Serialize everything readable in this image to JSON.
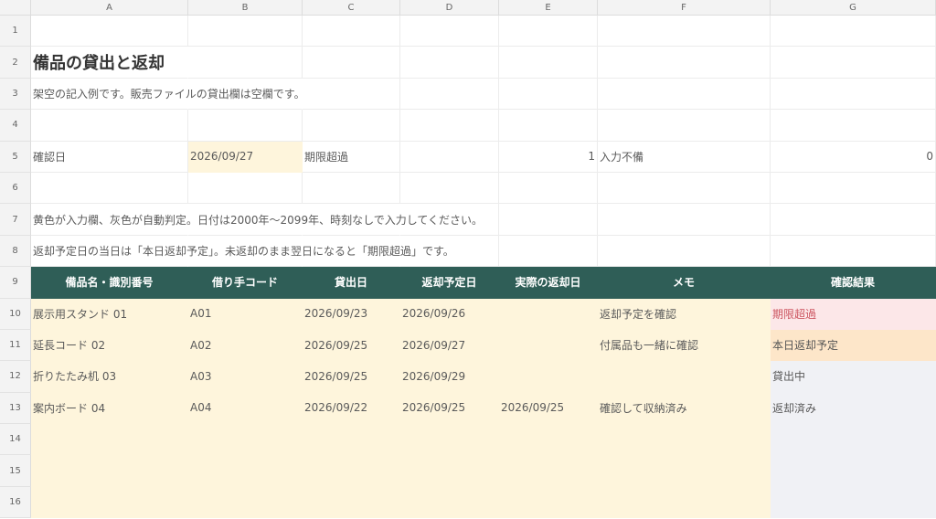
{
  "sheet": {
    "column_headers": [
      "A",
      "B",
      "C",
      "D",
      "E",
      "F",
      "G"
    ],
    "row_numbers": [
      "1",
      "2",
      "3",
      "4",
      "5",
      "6",
      "7",
      "8",
      "9",
      "10",
      "11",
      "12",
      "13",
      "14",
      "15",
      "16"
    ],
    "title": "備品の貸出と返却",
    "subtitle": "架空の記入例です。販売ファイルの貸出欄は空欄です。",
    "summary": {
      "date_label": "確認日",
      "date_value": "2026/09/27",
      "overdue_label": "期限超過",
      "overdue_count": "1",
      "missing_label": "入力不備",
      "missing_count": "0"
    },
    "notes": [
      "黄色が入力欄、灰色が自動判定。日付は2000年〜2099年、時刻なしで入力してください。",
      "返却予定日の当日は「本日返却予定」。未返却のまま翌日になると「期限超過」です。"
    ],
    "table": {
      "headers": [
        "備品名・識別番号",
        "借り手コード",
        "貸出日",
        "返却予定日",
        "実際の返却日",
        "メモ",
        "確認結果"
      ],
      "rows": [
        [
          "展示用スタンド 01",
          "A01",
          "2026/09/23",
          "2026/09/26",
          "",
          "返却予定を確認",
          "期限超過"
        ],
        [
          "延長コード 02",
          "A02",
          "2026/09/25",
          "2026/09/27",
          "",
          "付属品も一緒に確認",
          "本日返却予定"
        ],
        [
          "折りたたみ机 03",
          "A03",
          "2026/09/25",
          "2026/09/29",
          "",
          "",
          "貸出中"
        ],
        [
          "案内ボード 04",
          "A04",
          "2026/09/22",
          "2026/09/25",
          "2026/09/25",
          "確認して収納済み",
          "返却済み"
        ]
      ]
    }
  },
  "colors": {
    "header_green": "#2f5e57",
    "input_yellow": "#fef5dc",
    "auto_gray": "#f0f1f5",
    "overdue_pink": "#fce7e8",
    "today_orange": "#fde6c9"
  }
}
